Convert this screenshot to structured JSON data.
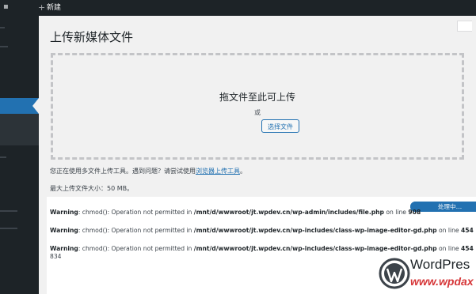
{
  "adminbar": {
    "new_label": "新建",
    "plus_symbol": "+"
  },
  "page": {
    "title": "上传新媒体文件"
  },
  "uploader": {
    "drop_text": "拖文件至此可上传",
    "or_text": "或",
    "select_button": "选择文件"
  },
  "info": {
    "multi_prefix": "您正在使用多文件上传工具。遇到问题？请尝试使用",
    "browser_link": "浏览器上传工具",
    "multi_suffix": "。",
    "max_size": "最大上传文件大小：50 MB。"
  },
  "upload": {
    "progress_label": "处理中…",
    "progress_fraction": 1.0,
    "warnings": [
      {
        "label": "Warning",
        "msg": ": chmod(): Operation not permitted in ",
        "path": "/mnt/d/wwwroot/jt.wpdev.cn/wp-admin/includes/file.php",
        "on_line": " on line ",
        "line": "908"
      },
      {
        "label": "Warning",
        "msg": ": chmod(): Operation not permitted in ",
        "path": "/mnt/d/wwwroot/jt.wpdev.cn/wp-includes/class-wp-image-editor-gd.php",
        "on_line": " on line ",
        "line": "454"
      },
      {
        "label": "Warning",
        "msg": ": chmod(): Operation not permitted in ",
        "path": "/mnt/d/wwwroot/jt.wpdev.cn/wp-includes/class-wp-image-editor-gd.php",
        "on_line": " on line ",
        "line": "454"
      }
    ],
    "trailing_number": "834"
  },
  "watermark": {
    "brand": "WordPres",
    "url": "www.wpdax"
  },
  "icons": {
    "wordpress_logo": "wordpress-logo-icon",
    "admin_logo": "wordpress-admin-icon",
    "add": "plus-icon"
  },
  "colors": {
    "accent": "#2271b1",
    "sidebar": "#1d2327",
    "watermark_red": "#d63638"
  }
}
